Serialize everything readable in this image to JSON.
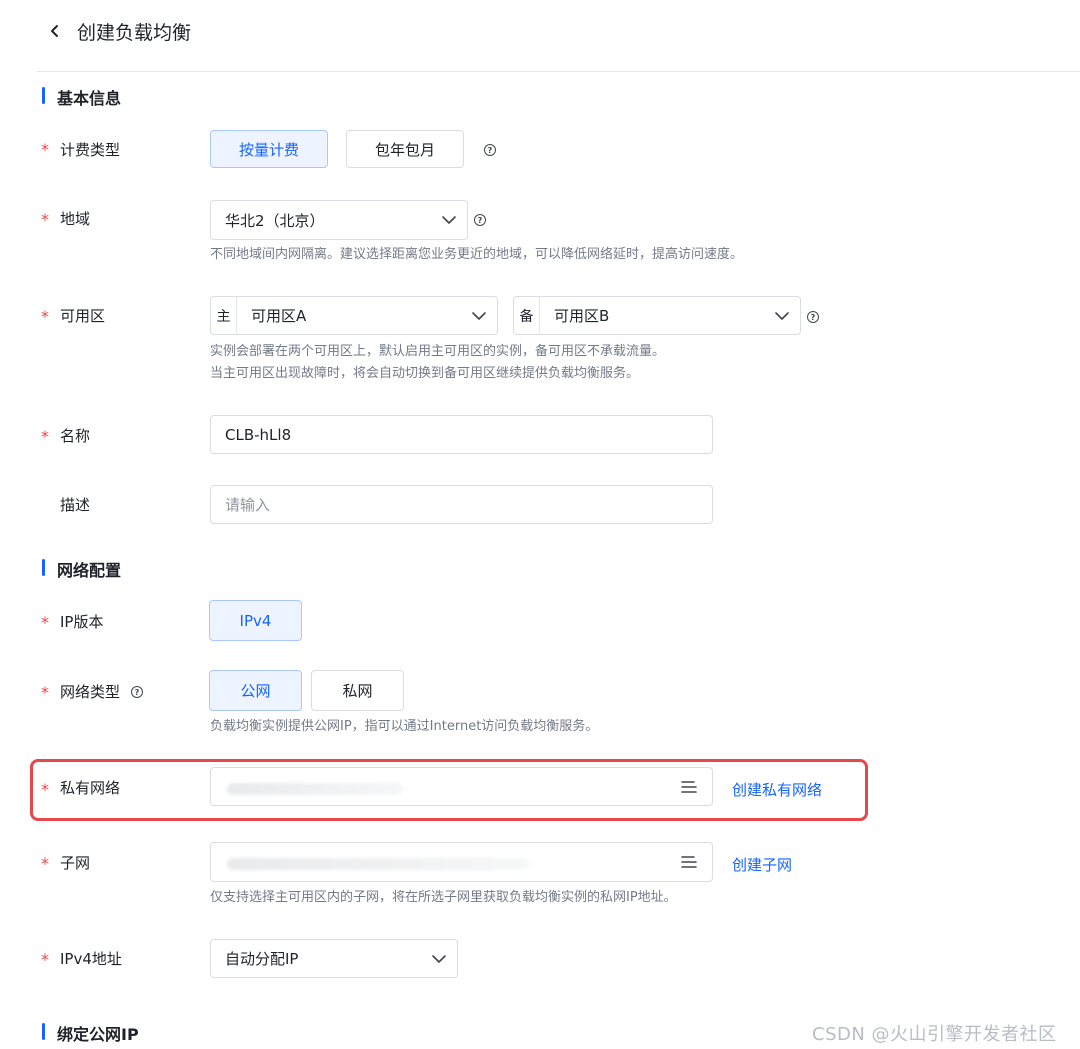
{
  "header": {
    "title": "创建负载均衡",
    "back_icon": "chevron-left-icon"
  },
  "sections": {
    "basic": {
      "title": "基本信息"
    },
    "network": {
      "title": "网络配置"
    },
    "eip": {
      "title": "绑定公网IP"
    }
  },
  "fields": {
    "billing": {
      "label": "计费类型",
      "options": [
        "按量计费",
        "包年包月"
      ],
      "selected": "按量计费"
    },
    "region": {
      "label": "地域",
      "value": "华北2（北京）",
      "hint": "不同地域间内网隔离。建议选择距离您业务更近的地域，可以降低网络延时，提高访问速度。"
    },
    "zone": {
      "label": "可用区",
      "primary_prefix": "主",
      "primary_value": "可用区A",
      "backup_prefix": "备",
      "backup_value": "可用区B",
      "hint_line1": "实例会部署在两个可用区上，默认启用主可用区的实例，备可用区不承载流量。",
      "hint_line2": "当主可用区出现故障时，将会自动切换到备可用区继续提供负载均衡服务。"
    },
    "name": {
      "label": "名称",
      "value": "CLB-hLl8"
    },
    "description": {
      "label": "描述",
      "placeholder": "请输入"
    },
    "ip_version": {
      "label": "IP版本",
      "options": [
        "IPv4"
      ],
      "selected": "IPv4"
    },
    "network_type": {
      "label": "网络类型",
      "options": [
        "公网",
        "私网"
      ],
      "selected": "公网",
      "hint": "负载均衡实例提供公网IP，指可以通过Internet访问负载均衡服务。"
    },
    "vpc": {
      "label": "私有网络",
      "link": "创建私有网络"
    },
    "subnet": {
      "label": "子网",
      "link": "创建子网",
      "hint": "仅支持选择主可用区内的子网，将在所选子网里获取负载均衡实例的私网IP地址。"
    },
    "ipv4": {
      "label": "IPv4地址",
      "value": "自动分配IP"
    }
  },
  "required_mark": "*",
  "help_glyph": "?",
  "colors": {
    "accent": "#1664ff",
    "required": "#e5484d",
    "highlight": "#e5484d"
  },
  "watermark": "CSDN @火山引擎开发者社区"
}
